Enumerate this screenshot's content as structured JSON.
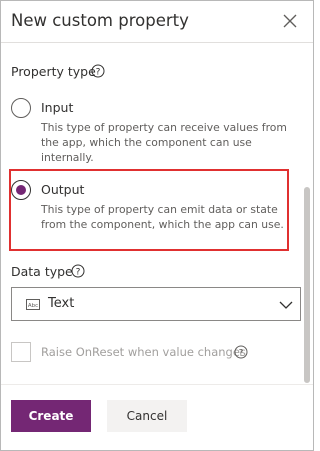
{
  "dialog": {
    "title": "New custom property"
  },
  "property_type": {
    "label": "Property type",
    "options": [
      {
        "title": "Input",
        "description": "This type of property can receive values from the app, which the component can use internally.",
        "selected": false
      },
      {
        "title": "Output",
        "description": "This type of property can emit data or state from the component, which the app can use.",
        "selected": true
      }
    ]
  },
  "data_type": {
    "label": "Data type",
    "selected": "Text",
    "icon": "text-type-icon"
  },
  "raise_on_reset": {
    "label": "Raise OnReset when value changes",
    "checked": false,
    "disabled": true
  },
  "footer": {
    "create_label": "Create",
    "cancel_label": "Cancel"
  },
  "colors": {
    "accent": "#742774",
    "highlight_border": "#e03030"
  }
}
